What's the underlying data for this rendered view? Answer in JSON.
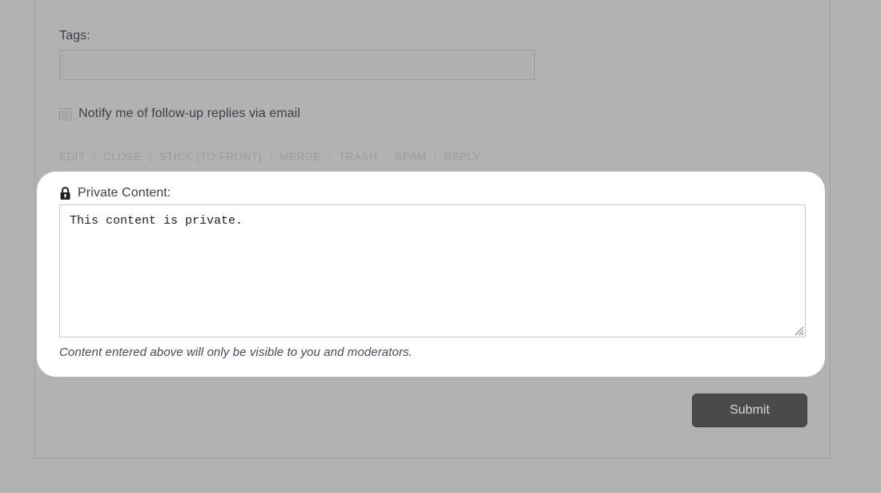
{
  "theme": {
    "page_background": "#b2b2b2",
    "panel_background": "#ffffff",
    "text_color": "#3d3d4a",
    "muted_link_color": "#9b9b9b",
    "submit_background": "#4a4a4a",
    "submit_text_color": "#d8d8d8"
  },
  "form": {
    "tags": {
      "label": "Tags:",
      "value": "",
      "placeholder": ""
    },
    "notify": {
      "label": "Notify me of follow-up replies via email",
      "checked": false
    },
    "actions": [
      {
        "label": "EDIT"
      },
      {
        "label": "CLOSE"
      },
      {
        "label": "STICK (TO FRONT)"
      },
      {
        "label": "MERGE"
      },
      {
        "label": "TRASH"
      },
      {
        "label": "SPAM"
      },
      {
        "label": "REPLY"
      }
    ],
    "action_separator": "|",
    "submit": {
      "label": "Submit"
    }
  },
  "private_panel": {
    "icon": "lock-icon",
    "title": "Private Content:",
    "textarea": {
      "value": "This content is private.",
      "placeholder": ""
    },
    "note": "Content entered above will only be visible to you and moderators."
  }
}
